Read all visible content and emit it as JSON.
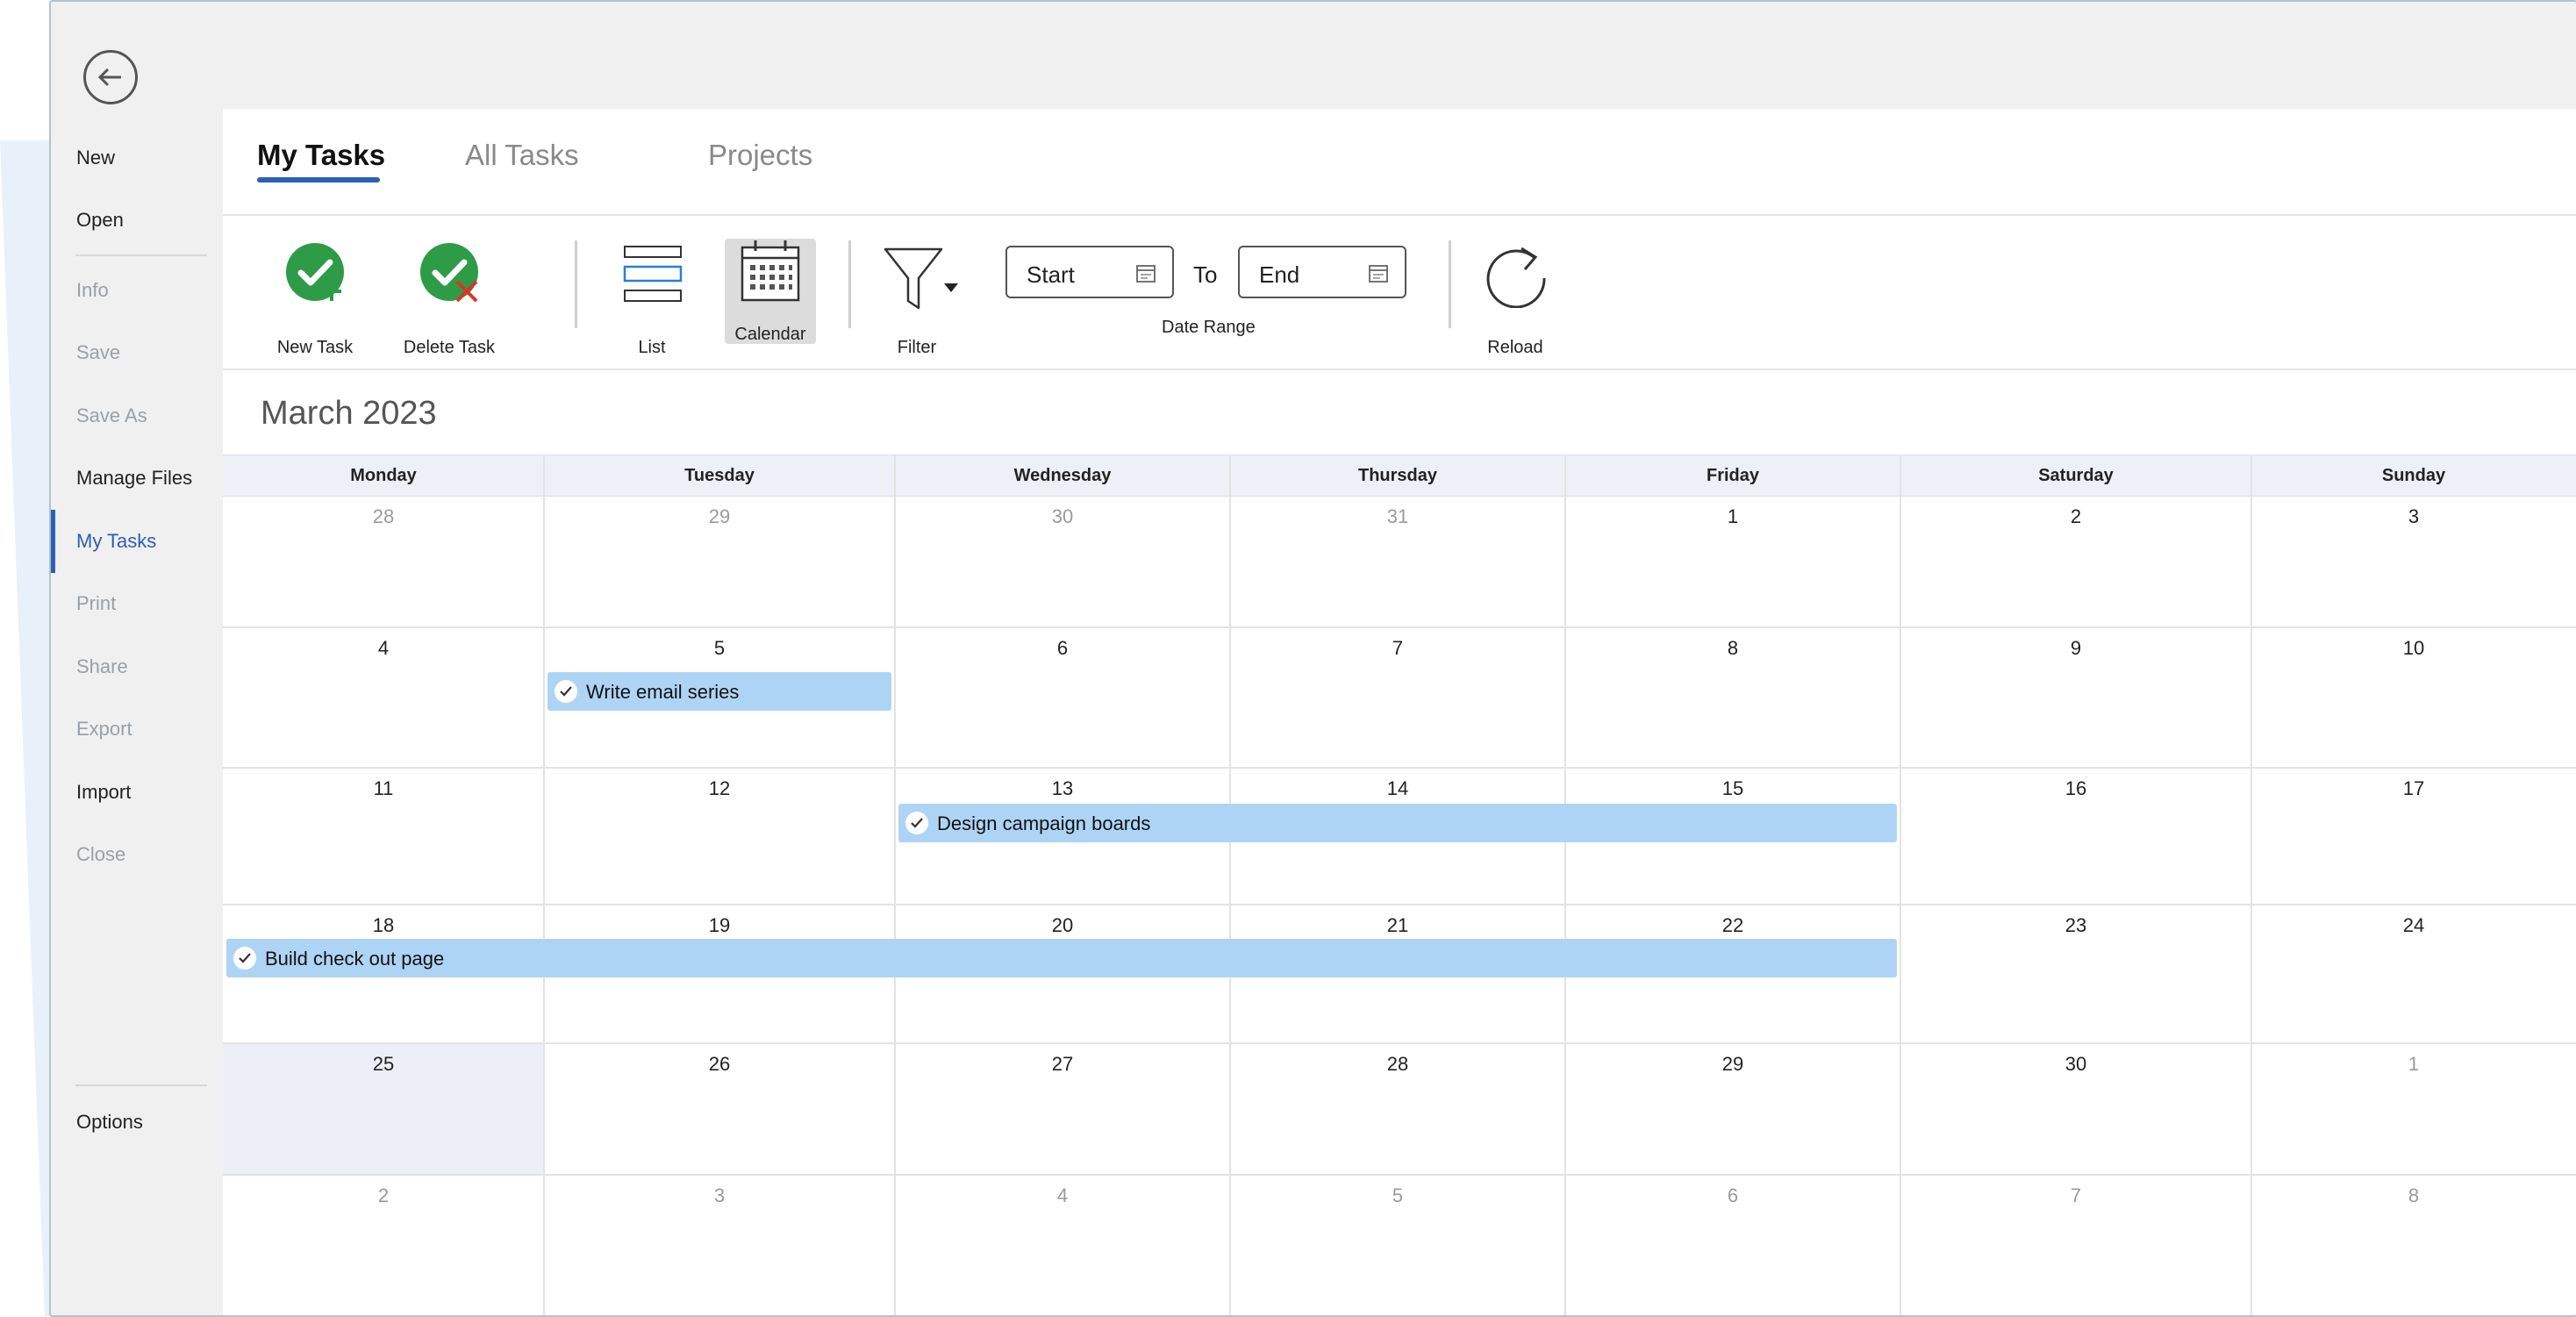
{
  "sidebar": {
    "items": [
      {
        "label": "New"
      },
      {
        "label": "Open"
      },
      {
        "label": "Info"
      },
      {
        "label": "Save"
      },
      {
        "label": "Save As"
      },
      {
        "label": "Manage Files"
      },
      {
        "label": "My Tasks"
      },
      {
        "label": "Print"
      },
      {
        "label": "Share"
      },
      {
        "label": "Export"
      },
      {
        "label": "Import"
      },
      {
        "label": "Close"
      },
      {
        "label": "Options"
      }
    ],
    "active_item": "My Tasks"
  },
  "tabs": [
    {
      "label": "My Tasks",
      "active": true
    },
    {
      "label": "All Tasks",
      "active": false
    },
    {
      "label": "Projects",
      "active": false
    }
  ],
  "ribbon": {
    "new_task": "New Task",
    "delete_task": "Delete Task",
    "list": "List",
    "calendar": "Calendar",
    "filter": "Filter",
    "start_placeholder": "Start",
    "to_label": "To",
    "end_placeholder": "End",
    "date_range": "Date Range",
    "reload": "Reload"
  },
  "calendar": {
    "month_title": "March 2023",
    "weekdays": [
      "Monday",
      "Tuesday",
      "Wednesday",
      "Thursday",
      "Friday",
      "Saturday",
      "Sunday"
    ],
    "weeks": [
      [
        "28",
        "29",
        "30",
        "31",
        "1",
        "2",
        "3"
      ],
      [
        "4",
        "5",
        "6",
        "7",
        "8",
        "9",
        "10"
      ],
      [
        "11",
        "12",
        "13",
        "14",
        "15",
        "16",
        "17"
      ],
      [
        "18",
        "19",
        "20",
        "21",
        "22",
        "23",
        "24"
      ],
      [
        "25",
        "26",
        "27",
        "28",
        "29",
        "30",
        "1"
      ],
      [
        "2",
        "3",
        "4",
        "5",
        "6",
        "7",
        "8"
      ]
    ],
    "today": "25",
    "events": [
      {
        "title": "Write email series",
        "start": "March 5",
        "end": "March 5"
      },
      {
        "title": "Design campaign boards",
        "start": "March 13",
        "end": "March 15"
      },
      {
        "title": "Build check out page",
        "start": "March 18",
        "end": "March 22"
      }
    ]
  },
  "colors": {
    "accent": "#2b5fb4",
    "event_fill": "#aed4f5",
    "check_green": "#2e9b47",
    "delete_red": "#d9342b",
    "header_row": "#eef0f8"
  }
}
